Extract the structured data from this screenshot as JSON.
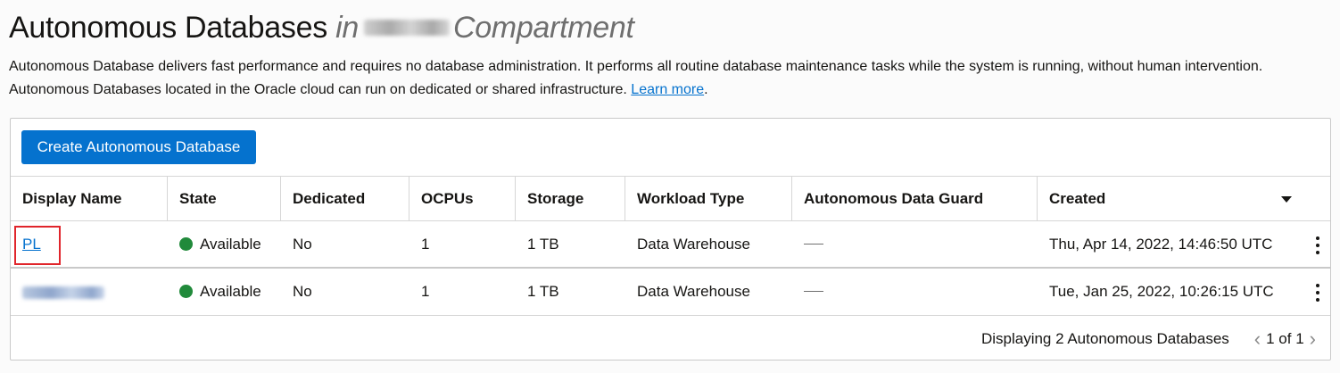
{
  "header": {
    "title": "Autonomous Databases",
    "in_text": "in",
    "compartment_suffix": "Compartment"
  },
  "description": {
    "text": "Autonomous Database delivers fast performance and requires no database administration. It performs all routine database maintenance tasks while the system is running, without human intervention. Autonomous Databases located in the Oracle cloud can run on dedicated or shared infrastructure. ",
    "link_label": "Learn more",
    "trailing": "."
  },
  "toolbar": {
    "create_label": "Create Autonomous Database"
  },
  "table": {
    "columns": [
      "Display Name",
      "State",
      "Dedicated",
      "OCPUs",
      "Storage",
      "Workload Type",
      "Autonomous Data Guard",
      "Created"
    ],
    "rows": [
      {
        "display_name": "PL",
        "state": "Available",
        "dedicated": "No",
        "ocpus": "1",
        "storage": "1 TB",
        "workload": "Data Warehouse",
        "data_guard": "—",
        "created": "Thu, Apr 14, 2022, 14:46:50 UTC"
      },
      {
        "display_name": "",
        "state": "Available",
        "dedicated": "No",
        "ocpus": "1",
        "storage": "1 TB",
        "workload": "Data Warehouse",
        "data_guard": "—",
        "created": "Tue, Jan 25, 2022, 10:26:15 UTC"
      }
    ]
  },
  "footer": {
    "count_text": "Displaying 2 Autonomous Databases",
    "page_text": "1 of 1"
  },
  "colors": {
    "accent": "#0572ce",
    "status_available": "#218a3b",
    "highlight_box": "#e0252b"
  },
  "icons": {
    "sort": "caret-down-icon",
    "status": "status-dot-icon",
    "actions": "kebab-menu-icon",
    "prev": "chevron-left-icon",
    "next": "chevron-right-icon"
  }
}
